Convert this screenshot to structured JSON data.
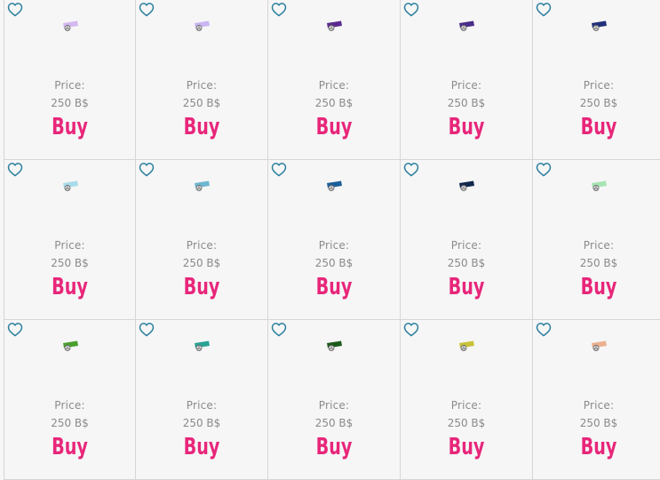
{
  "shop": {
    "items": [
      {
        "price_label": "Price:",
        "price_value": "250 B$",
        "buy_label": "Buy",
        "tag_color": "#d4b8f0",
        "favorite_icon": "heart-outline-icon"
      },
      {
        "price_label": "Price:",
        "price_value": "250 B$",
        "buy_label": "Buy",
        "tag_color": "#c9b6f2",
        "favorite_icon": "heart-outline-icon"
      },
      {
        "price_label": "Price:",
        "price_value": "250 B$",
        "buy_label": "Buy",
        "tag_color": "#5a2a8e",
        "favorite_icon": "heart-outline-icon"
      },
      {
        "price_label": "Price:",
        "price_value": "250 B$",
        "buy_label": "Buy",
        "tag_color": "#4a2d8a",
        "favorite_icon": "heart-outline-icon"
      },
      {
        "price_label": "Price:",
        "price_value": "250 B$",
        "buy_label": "Buy",
        "tag_color": "#23307a",
        "favorite_icon": "heart-outline-icon"
      },
      {
        "price_label": "Price:",
        "price_value": "250 B$",
        "buy_label": "Buy",
        "tag_color": "#a9dcea",
        "favorite_icon": "heart-outline-icon"
      },
      {
        "price_label": "Price:",
        "price_value": "250 B$",
        "buy_label": "Buy",
        "tag_color": "#6fb7d1",
        "favorite_icon": "heart-outline-icon"
      },
      {
        "price_label": "Price:",
        "price_value": "250 B$",
        "buy_label": "Buy",
        "tag_color": "#1b5f98",
        "favorite_icon": "heart-outline-icon"
      },
      {
        "price_label": "Price:",
        "price_value": "250 B$",
        "buy_label": "Buy",
        "tag_color": "#12284e",
        "favorite_icon": "heart-outline-icon"
      },
      {
        "price_label": "Price:",
        "price_value": "250 B$",
        "buy_label": "Buy",
        "tag_color": "#a7e4b3",
        "favorite_icon": "heart-outline-icon"
      },
      {
        "price_label": "Price:",
        "price_value": "250 B$",
        "buy_label": "Buy",
        "tag_color": "#4a9e2c",
        "favorite_icon": "heart-outline-icon"
      },
      {
        "price_label": "Price:",
        "price_value": "250 B$",
        "buy_label": "Buy",
        "tag_color": "#2aa394",
        "favorite_icon": "heart-outline-icon"
      },
      {
        "price_label": "Price:",
        "price_value": "250 B$",
        "buy_label": "Buy",
        "tag_color": "#1c5a1c",
        "favorite_icon": "heart-outline-icon"
      },
      {
        "price_label": "Price:",
        "price_value": "250 B$",
        "buy_label": "Buy",
        "tag_color": "#c9c23a",
        "favorite_icon": "heart-outline-icon"
      },
      {
        "price_label": "Price:",
        "price_value": "250 B$",
        "buy_label": "Buy",
        "tag_color": "#ebb08f",
        "favorite_icon": "heart-outline-icon"
      }
    ]
  },
  "colors": {
    "buy": "#e8267a",
    "heart": "#2a7f9e",
    "price_text": "#8a8a8a",
    "card_bg": "#f6f6f6",
    "border": "#d6d6d6"
  }
}
